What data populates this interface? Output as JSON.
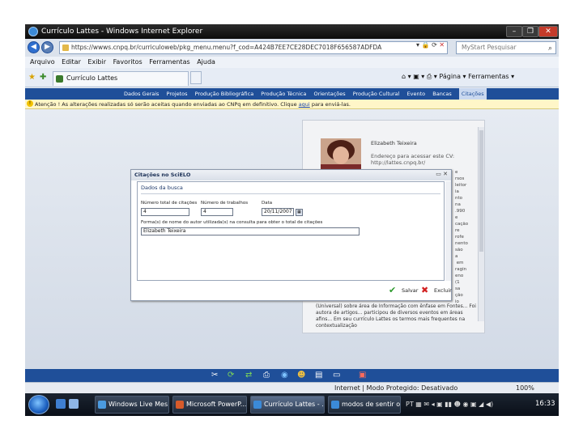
{
  "browser": {
    "window_title": "Currículo Lattes - Windows Internet Explorer",
    "url": "https://wwws.cnpq.br/curriculoweb/pkg_menu.menu?f_cod=A424B7EE7CE28DEC7018F656587ADFDA",
    "search_placeholder": "MyStart Pesquisar",
    "menu": [
      "Arquivo",
      "Editar",
      "Exibir",
      "Favoritos",
      "Ferramentas",
      "Ajuda"
    ],
    "tab_title": "Currículo Lattes",
    "command_bar": "Página ▾ Ferramentas ▾",
    "zone_status": "Internet | Modo Protegido: Desativado",
    "zoom": "100%"
  },
  "site_nav": {
    "items": [
      "Dados Gerais",
      "Projetos",
      "Produção Bibliográfica",
      "Produção Técnica",
      "Orientações",
      "Produção Cultural",
      "Evento",
      "Bancas",
      "Citações"
    ],
    "active_index": 8
  },
  "info_bar": {
    "text_before": "Atenção ! As alterações realizadas só serão aceitas quando enviadas ao CNPq em definitivo. Clique",
    "link": "aqui",
    "text_after": "para enviá-las."
  },
  "profile": {
    "name": "Elizabeth Teixeira",
    "link_text": "Endereço para acessar este CV: http://lattes.cnpq.br/",
    "side_text": "e\nrsos\nleitor\nia\nnto\nna\n.990\ne\ncação\nre\nrofe\nnento\nsão\na\n em\nragin\neno\n(1\nsa\nção\nio",
    "bottom_text": "(Universal) sobre área de Informação com ênfase em Fontes... Foi autora de artigos... participou de diversos eventos em áreas afins... Em seu currículo Lattes os termos mais frequentes na contextualização"
  },
  "dialog": {
    "title": "Citações no SciELO",
    "section": "Dados da busca",
    "field_total_label": "Número total de citações",
    "field_total_value": "4",
    "field_articles_label": "Número de trabalhos",
    "field_articles_value": "4",
    "field_date_label": "Data",
    "field_date_value": "20/11/2007",
    "field_name_label": "Forma(s) de nome do autor utilizada(s) na consulta para obter o total de citações",
    "field_name_value": "Elizabeth Teixeira",
    "save_label": "Salvar",
    "exit_label": "Excluir"
  },
  "taskbar": {
    "buttons": [
      "Windows Live Mes...",
      "Microsoft PowerP...",
      "Currículo Lattes - ...",
      "modos de sentir o ..."
    ],
    "active_index": 2,
    "tray_lang": "PT",
    "clock": "16:33"
  },
  "colors": {
    "nav_blue": "#1f4f99",
    "info_yellow": "#fff6c8",
    "close_red": "#c43b2b"
  }
}
